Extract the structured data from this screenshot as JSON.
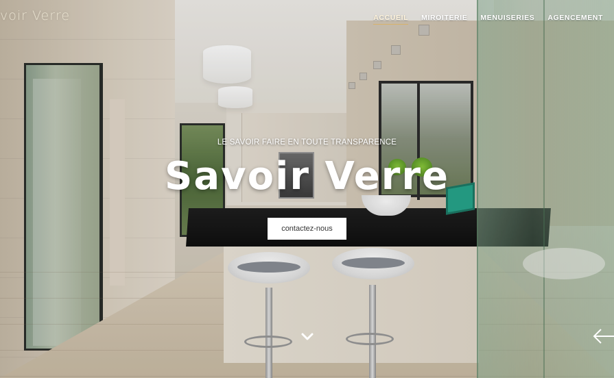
{
  "site": {
    "logo_text": "voir Verre"
  },
  "nav": {
    "items": [
      {
        "label": "ACCUEIL",
        "active": true
      },
      {
        "label": "MIROITERIE",
        "active": false
      },
      {
        "label": "MENUISERIES",
        "active": false
      },
      {
        "label": "AGENCEMENT",
        "active": false
      }
    ]
  },
  "hero": {
    "tagline": "LE SAVOIR FAIRE EN TOUTE TRANSPARENCE",
    "headline": "Savoir Verre",
    "cta_label": "contactez-nous",
    "scroll_icon": "chevron-down-icon",
    "prev_icon": "arrow-left-icon",
    "accent_color": "#d8b26a"
  }
}
